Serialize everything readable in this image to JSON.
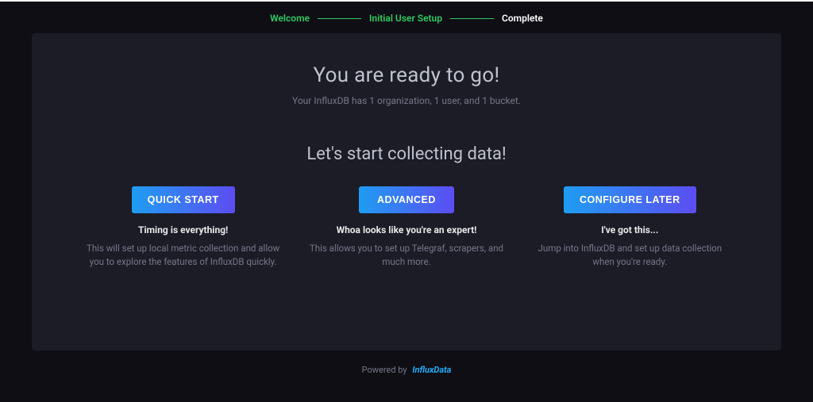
{
  "wizard": {
    "steps": [
      "Welcome",
      "Initial User Setup",
      "Complete"
    ],
    "current_index": 2
  },
  "page": {
    "headline": "You are ready to go!",
    "subtext": "Your InfluxDB has 1 organization, 1 user, and 1 bucket.",
    "subhead": "Let's start collecting data!"
  },
  "options": [
    {
      "button": "QUICK START",
      "title": "Timing is everything!",
      "desc": "This will set up local metric collection and allow you to explore the features of InfluxDB quickly."
    },
    {
      "button": "ADVANCED",
      "title": "Whoa looks like you're an expert!",
      "desc": "This allows you to set up Telegraf, scrapers, and much more."
    },
    {
      "button": "CONFIGURE LATER",
      "title": "I've got this...",
      "desc": "Jump into InfluxDB and set up data collection when you're ready."
    }
  ],
  "footer": {
    "prefix": "Powered by",
    "brand": "InfluxData"
  }
}
